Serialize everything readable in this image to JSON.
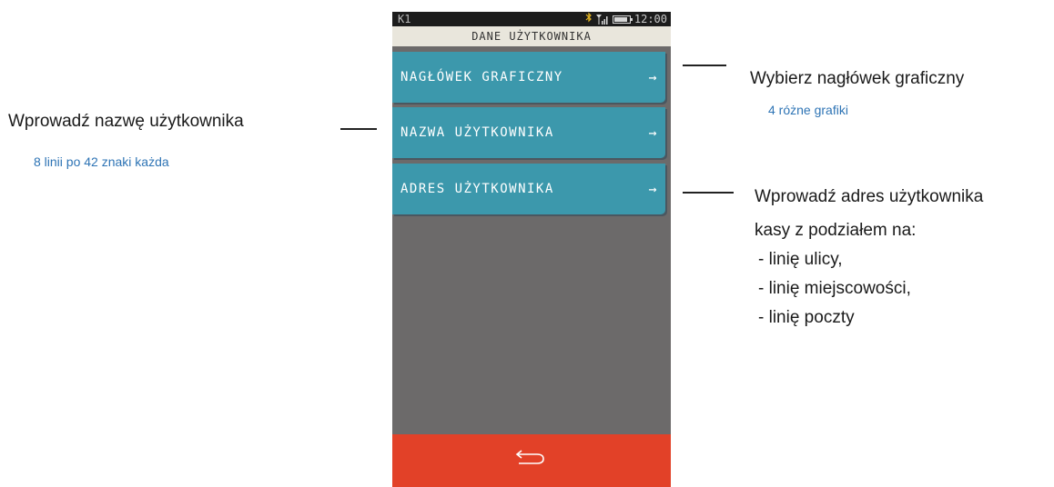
{
  "statusbar": {
    "left_label": "K1",
    "time": "12:00",
    "icons": [
      "bluetooth-icon",
      "signal-icon",
      "battery-icon"
    ]
  },
  "screen": {
    "title": "DANE UŻYTKOWNIKA",
    "menu": [
      {
        "label": "NAGŁÓWEK GRAFICZNY",
        "arrow": "→"
      },
      {
        "label": "NAZWA UŻYTKOWNIKA",
        "arrow": "→"
      },
      {
        "label": "ADRES UŻYTKOWNIKA",
        "arrow": "→"
      }
    ],
    "back_icon": "back-arrow-icon"
  },
  "annotations": {
    "header": {
      "title": "Wybierz nagłówek graficzny",
      "subtitle": "4 różne grafiki"
    },
    "name": {
      "title": "Wprowadź nazwę użytkownika",
      "subtitle": "8 linii po 42 znaki każda"
    },
    "address": {
      "title": "Wprowadź adres użytkownika",
      "lines": [
        "kasy z podziałem na:",
        "- linię ulicy,",
        "- linię miejscowości,",
        "- linię poczty"
      ]
    }
  },
  "colors": {
    "menu_bg": "#3c98ac",
    "screen_bg": "#6c6a6a",
    "back_bar": "#e24128",
    "title_bar": "#e9e6dc",
    "annotation_sub": "#2e74b5"
  }
}
